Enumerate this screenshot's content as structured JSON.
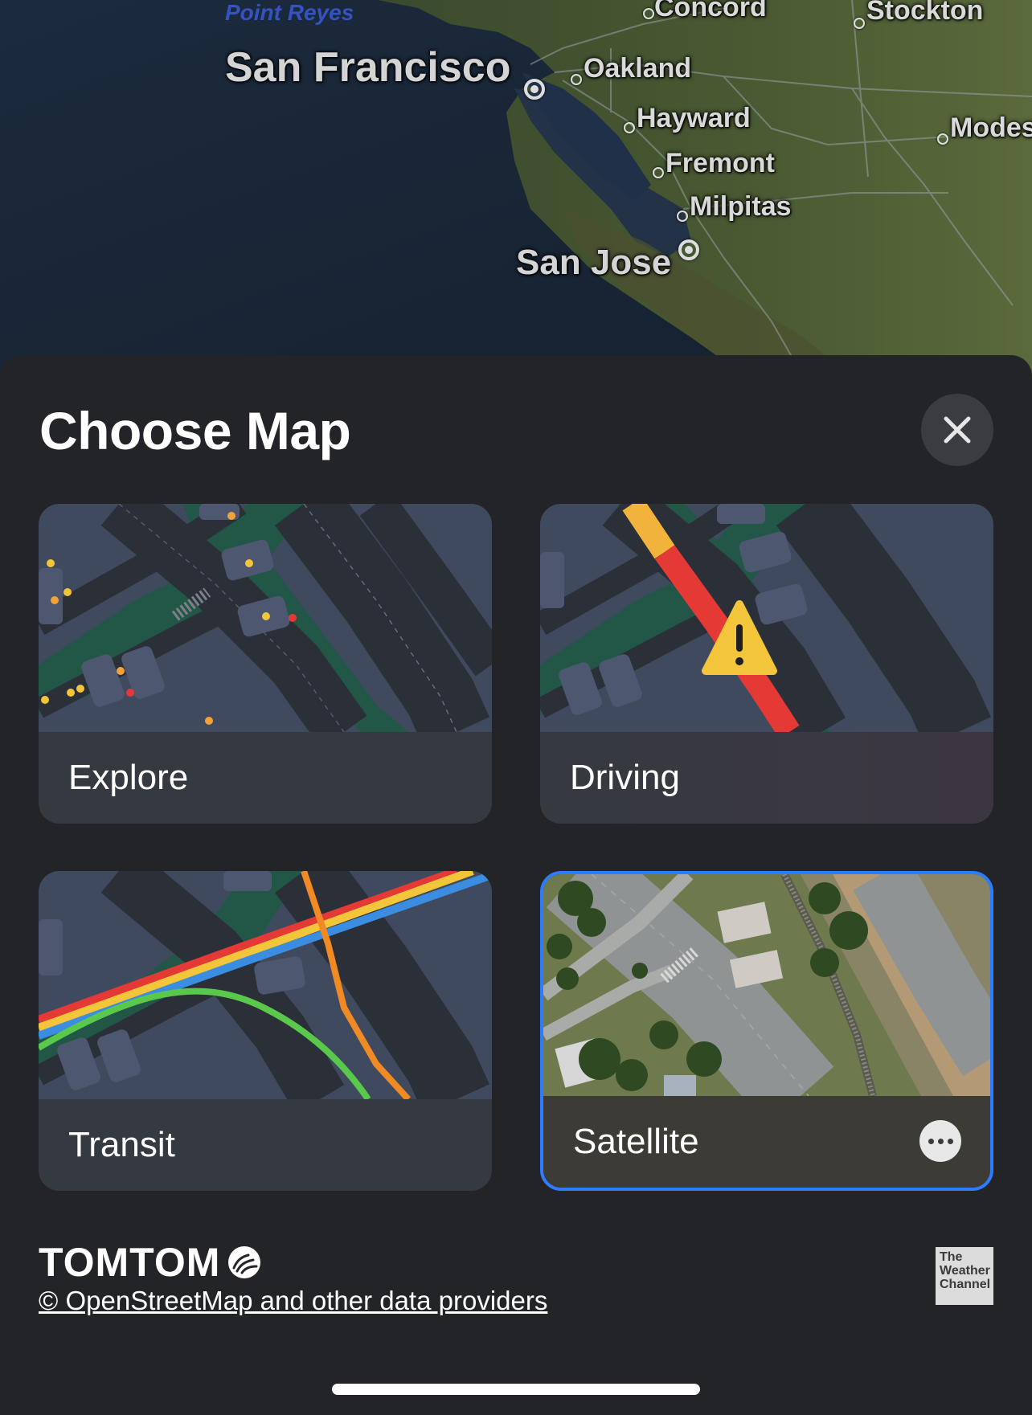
{
  "map": {
    "cities": {
      "point_reyes": "Point Reyes",
      "san_francisco": "San Francisco",
      "concord": "Concord",
      "stockton": "Stockton",
      "oakland": "Oakland",
      "hayward": "Hayward",
      "modesto": "Modes",
      "fremont": "Fremont",
      "milpitas": "Milpitas",
      "san_jose": "San Jose"
    }
  },
  "sheet": {
    "title": "Choose Map",
    "close_icon": "xmark-icon",
    "options": [
      {
        "label": "Explore",
        "selected": false
      },
      {
        "label": "Driving",
        "selected": false
      },
      {
        "label": "Transit",
        "selected": false
      },
      {
        "label": "Satellite",
        "selected": true,
        "more_icon": "ellipsis-icon"
      }
    ],
    "attribution": {
      "brand": "TOMTOM",
      "osm_text": "© OpenStreetMap and other data providers",
      "weather_badge": [
        "The",
        "Weather",
        "Channel"
      ]
    }
  },
  "colors": {
    "sheet_bg": "#222428",
    "card_bg": "#353940",
    "selected_border": "#2d7bff",
    "traffic_red": "#e53935",
    "traffic_yellow": "#f2b33d"
  }
}
